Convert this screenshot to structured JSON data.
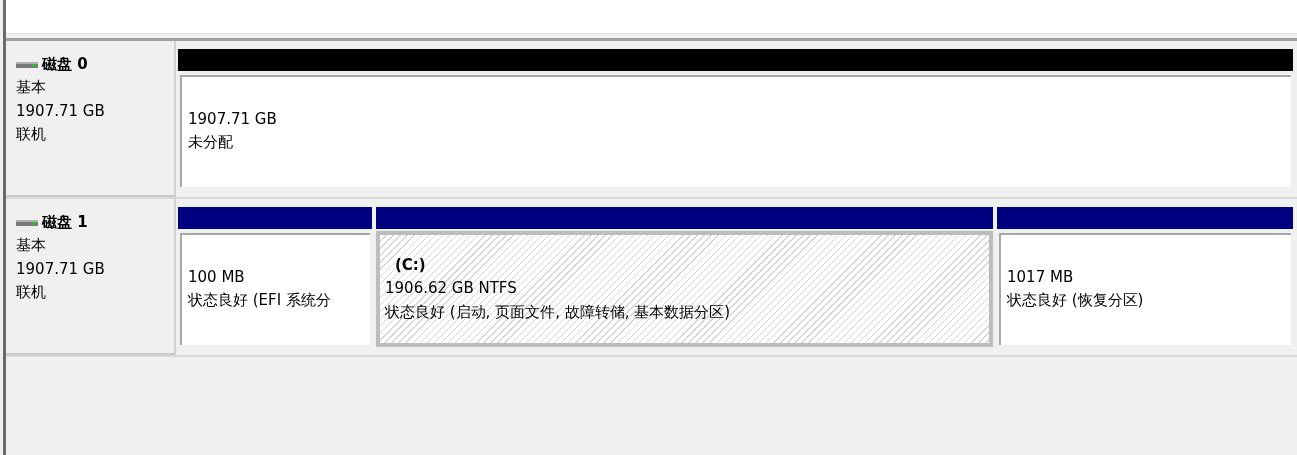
{
  "disks": [
    {
      "name": "磁盘 0",
      "type": "基本",
      "size": "1907.71 GB",
      "status": "联机",
      "partitions": [
        {
          "kind": "unallocated",
          "selected": false,
          "size": "1907.71 GB",
          "status": "未分配"
        }
      ]
    },
    {
      "name": "磁盘 1",
      "type": "基本",
      "size": "1907.71 GB",
      "status": "联机",
      "partitions": [
        {
          "kind": "primary",
          "selected": false,
          "size": "100 MB",
          "status": "状态良好 (EFI 系统分"
        },
        {
          "kind": "primary",
          "selected": true,
          "label": "(C:)",
          "size": "1906.62 GB NTFS",
          "status": "状态良好 (启动, 页面文件, 故障转储, 基本数据分区)"
        },
        {
          "kind": "primary",
          "selected": false,
          "size": "1017 MB",
          "status": "状态良好 (恢复分区)"
        }
      ]
    }
  ]
}
